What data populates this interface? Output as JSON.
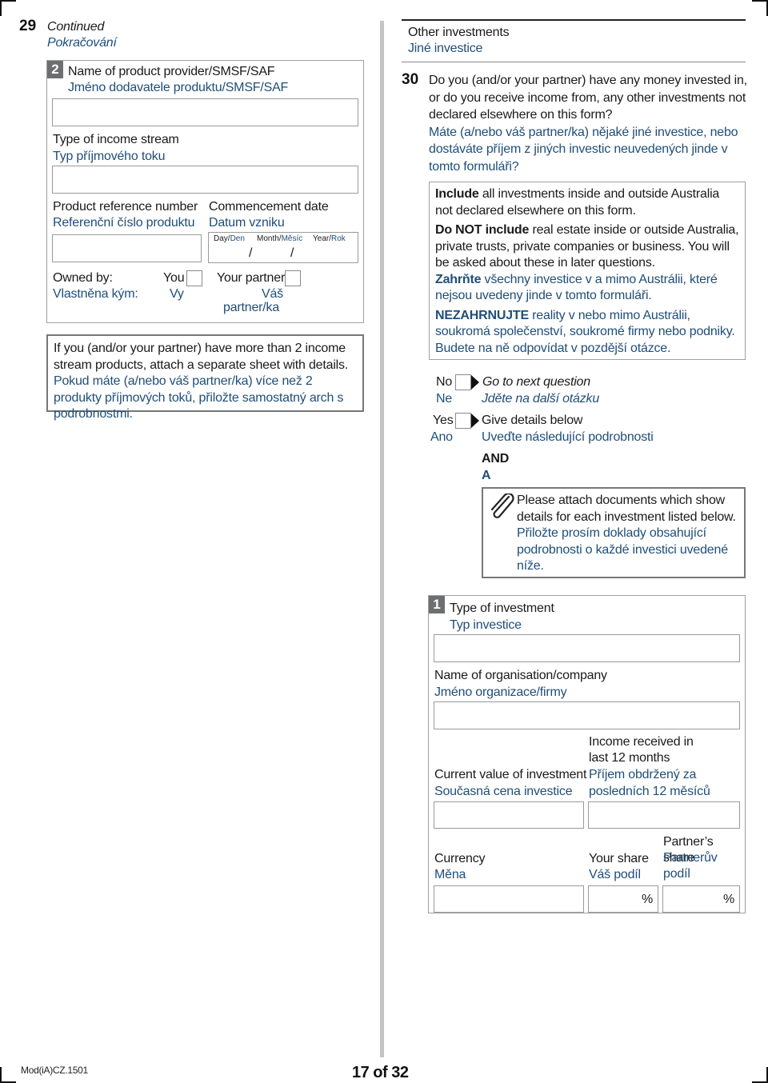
{
  "page": {
    "footer_code": "Mod(iA)CZ.1501",
    "page_number": "17 of 32"
  },
  "q29": {
    "number": "29",
    "continued_en": "Continued",
    "continued_cz": "Pokračování",
    "item2": {
      "badge": "2",
      "provider_en": "Name of product provider/SMSF/SAF",
      "provider_cz": "Jméno dodavatele produktu/SMSF/SAF",
      "provider_value": "",
      "stream_type_en": "Type of income stream",
      "stream_type_cz": "Typ příjmového toku",
      "stream_type_value": "",
      "ref_en": "Product reference number",
      "ref_cz": "Referenční číslo produktu",
      "ref_value": "",
      "date_en": "Commencement date",
      "date_cz": "Datum vzniku",
      "day_en": "Day/",
      "day_cz": "Den",
      "month_en": "Month/",
      "month_cz": "Měsíc",
      "year_en": "Year/",
      "year_cz": "Rok",
      "date_sep": "/",
      "owned_en": "Owned by:",
      "owned_cz": "Vlastněna kým:",
      "you_en": "You",
      "you_cz": "Vy",
      "partner_en": "Your partner",
      "partner_cz_1": "Váš",
      "partner_cz_2": "partner/ka"
    },
    "note_en": "If you (and/or your partner) have more than 2 income stream products, attach a separate sheet with details.",
    "note_cz": "Pokud máte (a/nebo váš partner/ka) více než 2 produkty příjmových toků, přiložte samostatný arch s podrobnostmi."
  },
  "section": {
    "title_en": "Other investments",
    "title_cz": "Jiné investice"
  },
  "q30": {
    "number": "30",
    "question_en": "Do you (and/or your partner) have any money invested in, or do you receive income from, any other investments not declared elsewhere on this form?",
    "question_cz": "Máte (a/nebo váš partner/ka) nějaké jiné investice, nebo dostáváte příjem z jiných investic neuvedených jinde v tomto formuláři?",
    "info": {
      "include_bold": "Include",
      "include_rest": " all investments inside and outside Australia not declared elsewhere on this form.",
      "exclude_bold": "Do NOT include",
      "exclude_rest": " real estate inside or outside Australia, private trusts, private companies or business. You will be asked about these in later questions.",
      "include_cz_bold": "Zahrňte",
      "include_cz_rest": " všechny investice v a mimo Austrálii, které nejsou uvedeny jinde v tomto formuláři.",
      "exclude_cz_bold": "NEZAHRNUJTE",
      "exclude_cz_rest": " reality v nebo mimo Austrálii, soukromá společenství, soukromé firmy nebo podniky. Budete na ně odpovídat v pozdější otázce."
    },
    "no_en": "No",
    "no_cz": "Ne",
    "no_action_en": "Go to next question",
    "no_action_cz": "Jděte na další otázku",
    "yes_en": "Yes",
    "yes_cz": "Ano",
    "yes_action_en": "Give details below",
    "yes_action_cz": "Uveďte následující podrobnosti",
    "and_en": "AND",
    "and_cz": "A",
    "attach_en": "Please attach documents which show details for each investment listed below.",
    "attach_cz": "Přiložte prosím doklady obsahující podrobnosti o každé investici uvedené níže.",
    "item1": {
      "badge": "1",
      "type_en": "Type of investment",
      "type_cz": "Typ investice",
      "type_value": "",
      "org_en": "Name of organisation/company",
      "org_cz": "Jméno organizace/firmy",
      "org_value": "",
      "value_en": "Current value of investment",
      "value_cz": "Současná cena investice",
      "value_value": "",
      "income_en_1": "Income received in",
      "income_en_2": "last 12 months",
      "income_cz_1": "Příjem obdržený za",
      "income_cz_2": "posledních 12 měsíců",
      "income_value": "",
      "currency_en": "Currency",
      "currency_cz": "Měna",
      "currency_value": "",
      "your_share_en": "Your share",
      "your_share_cz": "Váš podíl",
      "partner_share_en": "Partner’s share",
      "partner_share_cz_1": "Partnerův",
      "partner_share_cz_2": "podíl",
      "percent": "%"
    }
  }
}
